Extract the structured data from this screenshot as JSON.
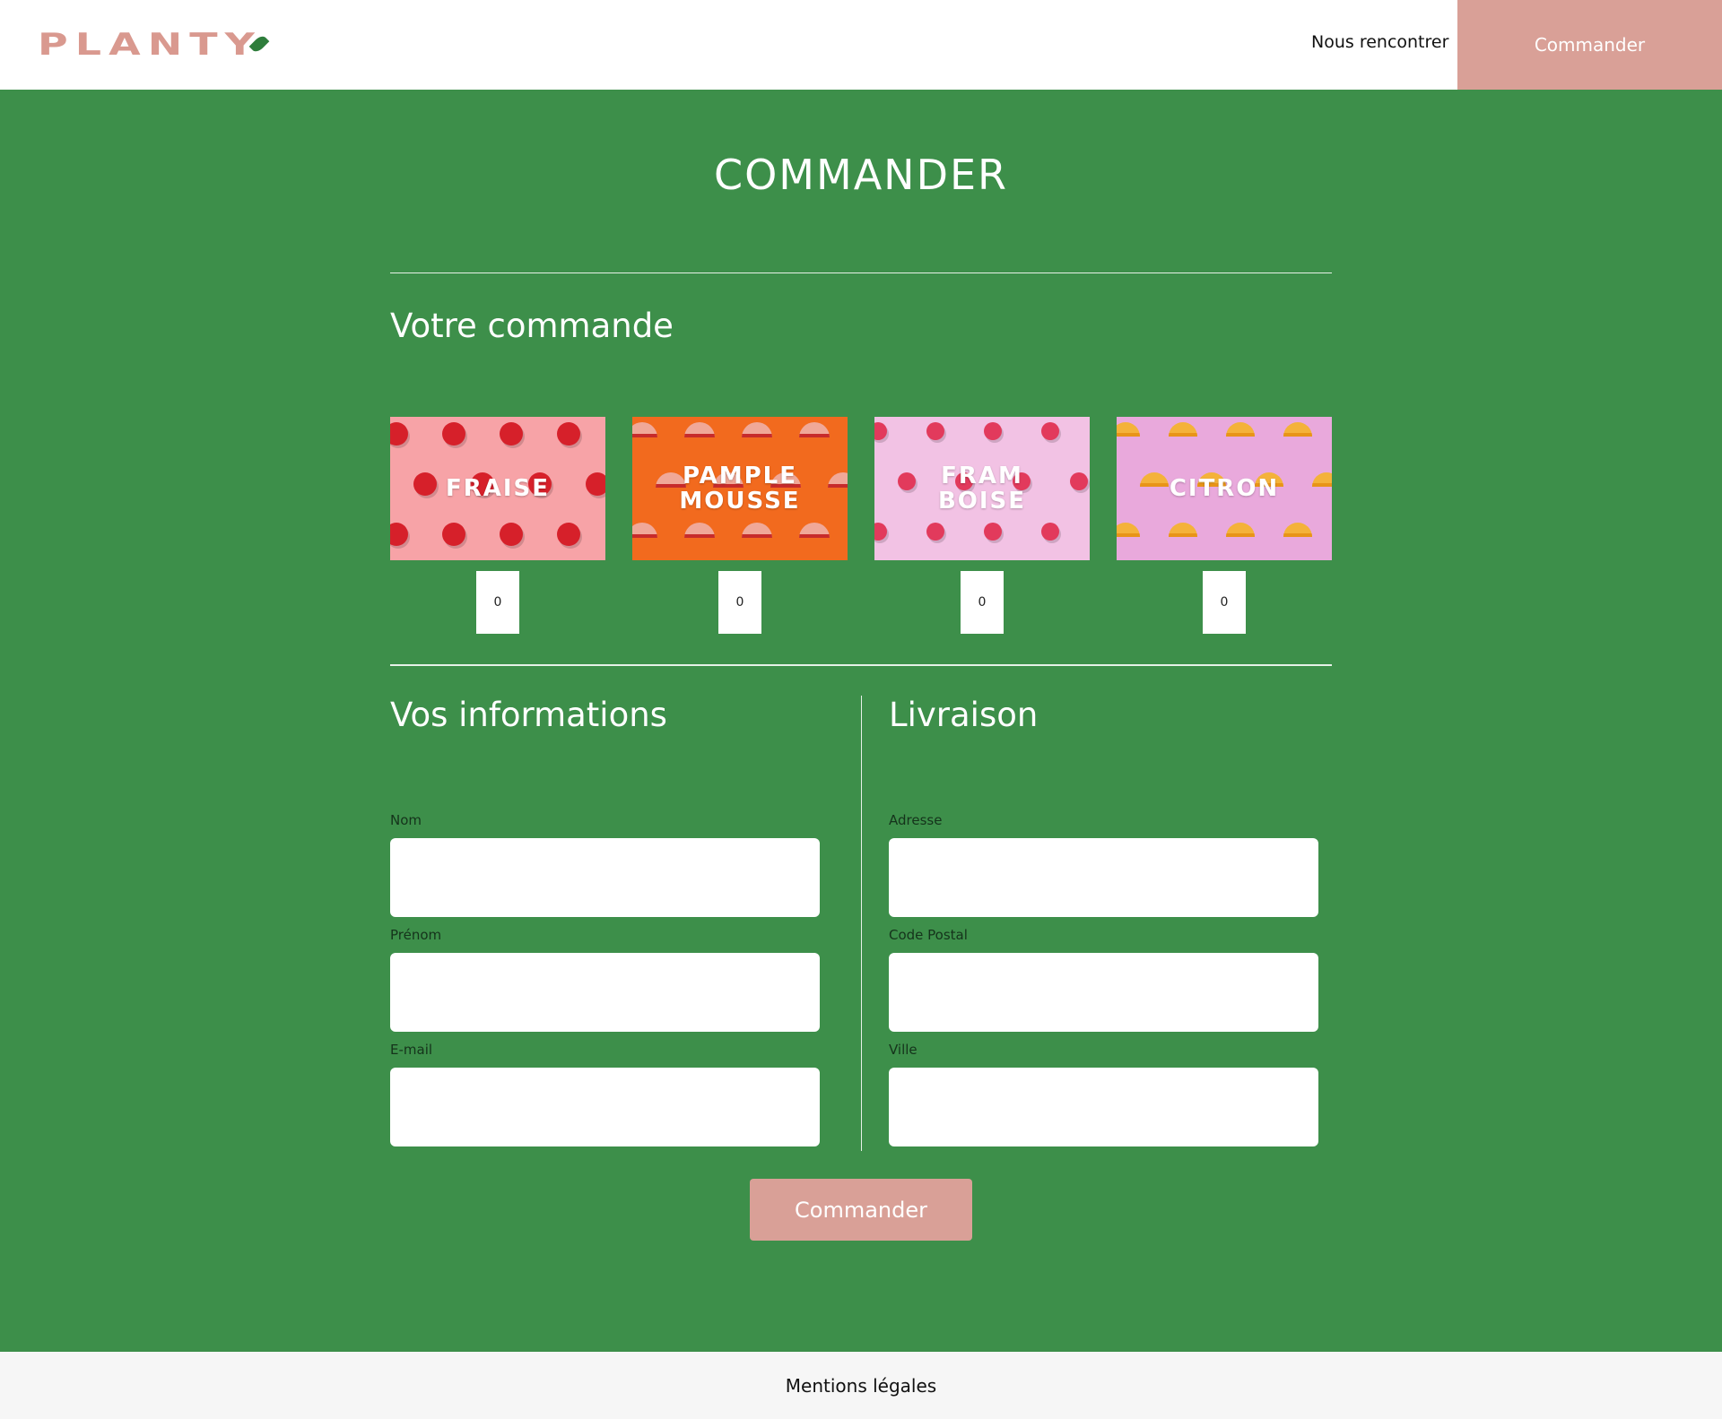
{
  "header": {
    "logo_text": "PLANTY",
    "nav_link": "Nous rencontrer",
    "nav_button": "Commander"
  },
  "page": {
    "title": "COMMANDER"
  },
  "order": {
    "title": "Votre commande",
    "products": [
      {
        "label": "FRAISE",
        "quantity": "0"
      },
      {
        "label": "PAMPLE\nMOUSSE",
        "quantity": "0"
      },
      {
        "label": "FRAM\nBOISE",
        "quantity": "0"
      },
      {
        "label": "CITRON",
        "quantity": "0"
      }
    ]
  },
  "info": {
    "title": "Vos informations",
    "fields": [
      {
        "label": "Nom",
        "value": ""
      },
      {
        "label": "Prénom",
        "value": ""
      },
      {
        "label": "E-mail",
        "value": ""
      }
    ]
  },
  "delivery": {
    "title": "Livraison",
    "fields": [
      {
        "label": "Adresse",
        "value": ""
      },
      {
        "label": "Code Postal",
        "value": ""
      },
      {
        "label": "Ville",
        "value": ""
      }
    ]
  },
  "submit_label": "Commander",
  "footer": {
    "link": "Mentions légales"
  },
  "colors": {
    "background": "#3d8f4a",
    "accent": "#d9a097",
    "strawberry_bg": "#f7a3a7",
    "grapefruit_bg": "#f26a1e",
    "raspberry_bg": "#f2c2e4",
    "lemon_bg": "#e9a9dc"
  }
}
